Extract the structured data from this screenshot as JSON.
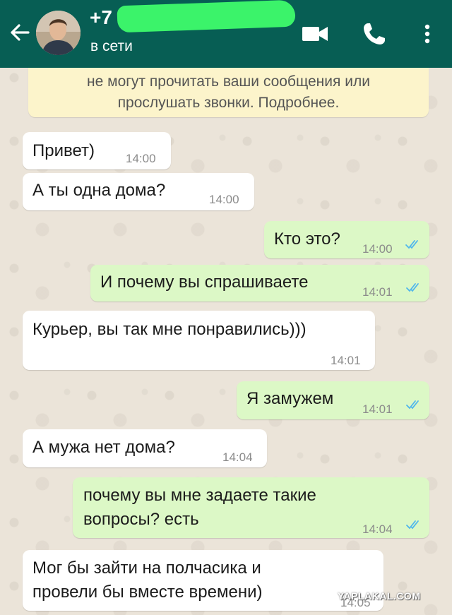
{
  "header": {
    "contact_name": "+7",
    "status": "в сети",
    "icons": [
      "back-arrow-icon",
      "video-call-icon",
      "phone-icon",
      "more-vert-icon"
    ]
  },
  "system_note": {
    "line1": "не могут прочитать ваши сообщения или",
    "line2": "прослушать звонки. Подробнее."
  },
  "messages": [
    {
      "dir": "in",
      "text": "Привет)",
      "time": "14:00"
    },
    {
      "dir": "in",
      "text": "А ты одна дома?",
      "time": "14:00"
    },
    {
      "dir": "out",
      "text": "Кто это?",
      "time": "14:00"
    },
    {
      "dir": "out",
      "text": "И почему вы спрашиваете",
      "time": "14:01"
    },
    {
      "dir": "in",
      "text": "Курьер, вы так мне понравились)))",
      "time": "14:01"
    },
    {
      "dir": "out",
      "text": "Я замужем",
      "time": "14:01"
    },
    {
      "dir": "in",
      "text": "А мужа нет дома?",
      "time": "14:04"
    },
    {
      "dir": "out",
      "line1": "почему вы мне задаете такие",
      "line2": "вопросы? есть",
      "time": "14:04"
    },
    {
      "dir": "in",
      "line1": "Мог бы зайти на полчасика и",
      "line2": "провели бы вместе времени)",
      "time": "14:05"
    }
  ],
  "watermark": "YAPLAKAL.COM",
  "colors": {
    "header": "#075e54",
    "incoming": "#ffffff",
    "outgoing": "#dcf8c6",
    "read_ticks": "#4fb6ec",
    "system_note": "#fcf4cb",
    "name_marker": "#3bf36a"
  }
}
